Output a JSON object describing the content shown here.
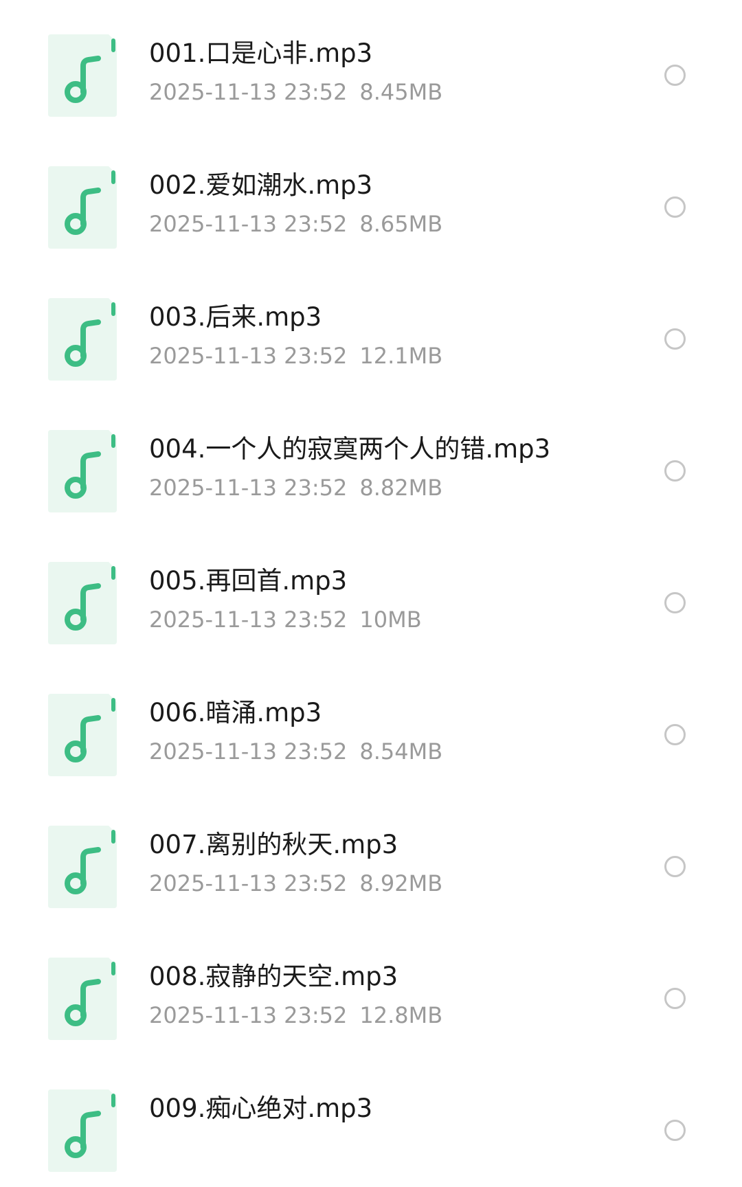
{
  "files": [
    {
      "name": "001.口是心非.mp3",
      "date": "2025-11-13 23:52",
      "size": "8.45MB",
      "icon": "music-file-icon"
    },
    {
      "name": "002.爱如潮水.mp3",
      "date": "2025-11-13 23:52",
      "size": "8.65MB",
      "icon": "music-file-icon"
    },
    {
      "name": "003.后来.mp3",
      "date": "2025-11-13 23:52",
      "size": "12.1MB",
      "icon": "music-file-icon"
    },
    {
      "name": "004.一个人的寂寞两个人的错.mp3",
      "date": "2025-11-13 23:52",
      "size": "8.82MB",
      "icon": "music-file-icon"
    },
    {
      "name": "005.再回首.mp3",
      "date": "2025-11-13 23:52",
      "size": "10MB",
      "icon": "music-file-icon"
    },
    {
      "name": "006.暗涌.mp3",
      "date": "2025-11-13 23:52",
      "size": "8.54MB",
      "icon": "music-file-icon"
    },
    {
      "name": "007.离别的秋天.mp3",
      "date": "2025-11-13 23:52",
      "size": "8.92MB",
      "icon": "music-file-icon"
    },
    {
      "name": "008.寂静的天空.mp3",
      "date": "2025-11-13 23:52",
      "size": "12.8MB",
      "icon": "music-file-icon"
    },
    {
      "name": "009.痴心绝对.mp3",
      "date": "",
      "size": "",
      "icon": "music-file-icon"
    }
  ],
  "colors": {
    "accent": "#3dbd84",
    "icon_bg": "#eaf7f0",
    "name_text": "#1a1a1a",
    "meta_text": "#9a9a9a",
    "radio_border": "#c6c6c6"
  }
}
